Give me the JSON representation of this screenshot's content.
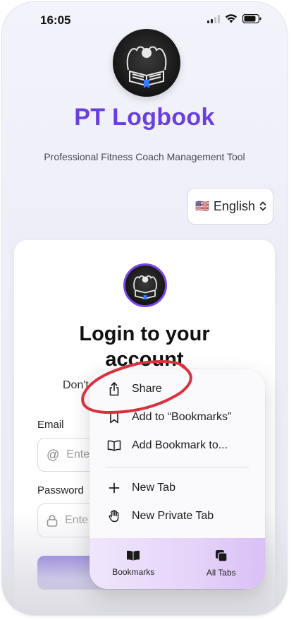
{
  "status_bar": {
    "time": "16:05"
  },
  "header": {
    "app_title": "PT Logbook",
    "subtitle": "Professional Fitness Coach Management Tool",
    "language": {
      "flag": "🇺🇸",
      "selected": "English"
    }
  },
  "login_card": {
    "heading_line1": "Login to your",
    "heading_line2": "account",
    "signup_prompt_partial": "Don't",
    "email_label": "Email",
    "email_placeholder_partial": "Ente",
    "password_label": "Password",
    "password_placeholder_partial": "Ente"
  },
  "context_menu": {
    "items": [
      {
        "label": "Share",
        "icon": "share-icon"
      },
      {
        "label": "Add to “Bookmarks”",
        "icon": "bookmark-icon"
      },
      {
        "label": "Add Bookmark to...",
        "icon": "book-icon"
      },
      {
        "label": "New Tab",
        "icon": "plus-icon"
      },
      {
        "label": "New Private Tab",
        "icon": "hand-icon"
      }
    ],
    "bottom": [
      {
        "label": "Bookmarks",
        "icon": "book-filled-icon"
      },
      {
        "label": "All Tabs",
        "icon": "tabs-icon"
      }
    ]
  },
  "colors": {
    "brand_purple": "#6a3fe0",
    "annotation_red": "#d9323f"
  }
}
